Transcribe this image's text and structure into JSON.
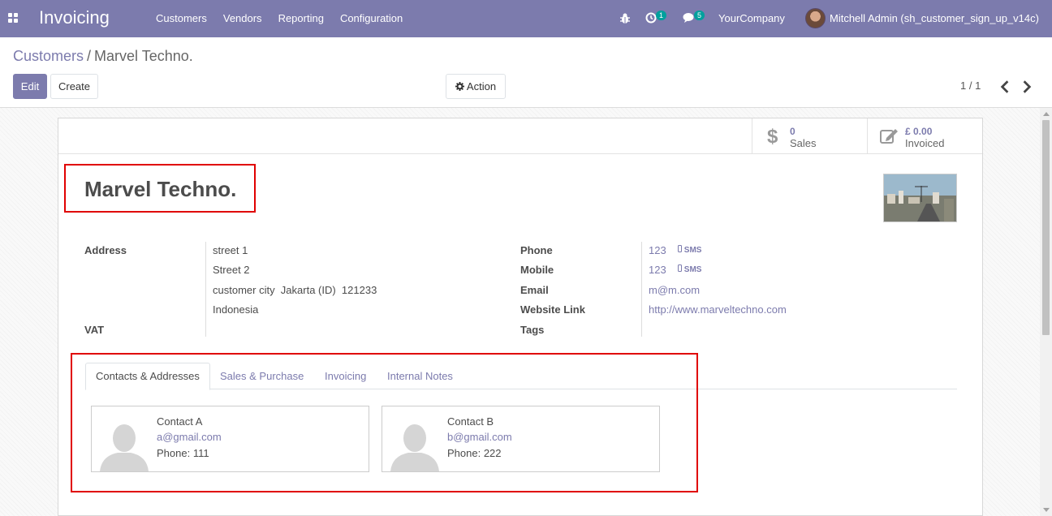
{
  "navbar": {
    "app_name": "Invoicing",
    "menu": [
      "Customers",
      "Vendors",
      "Reporting",
      "Configuration"
    ],
    "activity_count": "1",
    "message_count": "5",
    "company": "YourCompany",
    "user": "Mitchell Admin (sh_customer_sign_up_v14c)"
  },
  "breadcrumb": {
    "parent": "Customers",
    "separator": "/",
    "current": "Marvel Techno."
  },
  "buttons": {
    "edit": "Edit",
    "create": "Create",
    "action": "Action"
  },
  "pager": {
    "value": "1 / 1"
  },
  "stat_buttons": {
    "sales": {
      "value": "0",
      "label": "Sales"
    },
    "invoiced": {
      "value": "£ 0.00",
      "label": "Invoiced"
    }
  },
  "partner": {
    "name": "Marvel Techno.",
    "labels": {
      "address": "Address",
      "vat": "VAT",
      "phone": "Phone",
      "mobile": "Mobile",
      "email": "Email",
      "website": "Website Link",
      "tags": "Tags"
    },
    "street": "street 1",
    "street2": "Street 2",
    "city_line": "customer city  Jakarta (ID)  121233",
    "country": "Indonesia",
    "phone": "123",
    "mobile": "123",
    "sms_label": "SMS",
    "email": "m@m.com",
    "website": "http://www.marveltechno.com"
  },
  "tabs": [
    "Contacts & Addresses",
    "Sales & Purchase",
    "Invoicing",
    "Internal Notes"
  ],
  "contacts": [
    {
      "name": "Contact A",
      "email": "a@gmail.com",
      "phone": "Phone: 111"
    },
    {
      "name": "Contact B",
      "email": "b@gmail.com",
      "phone": "Phone: 222"
    }
  ],
  "colors": {
    "brand": "#7c7bad",
    "highlight": "#e00000",
    "badge": "#00a09d"
  }
}
